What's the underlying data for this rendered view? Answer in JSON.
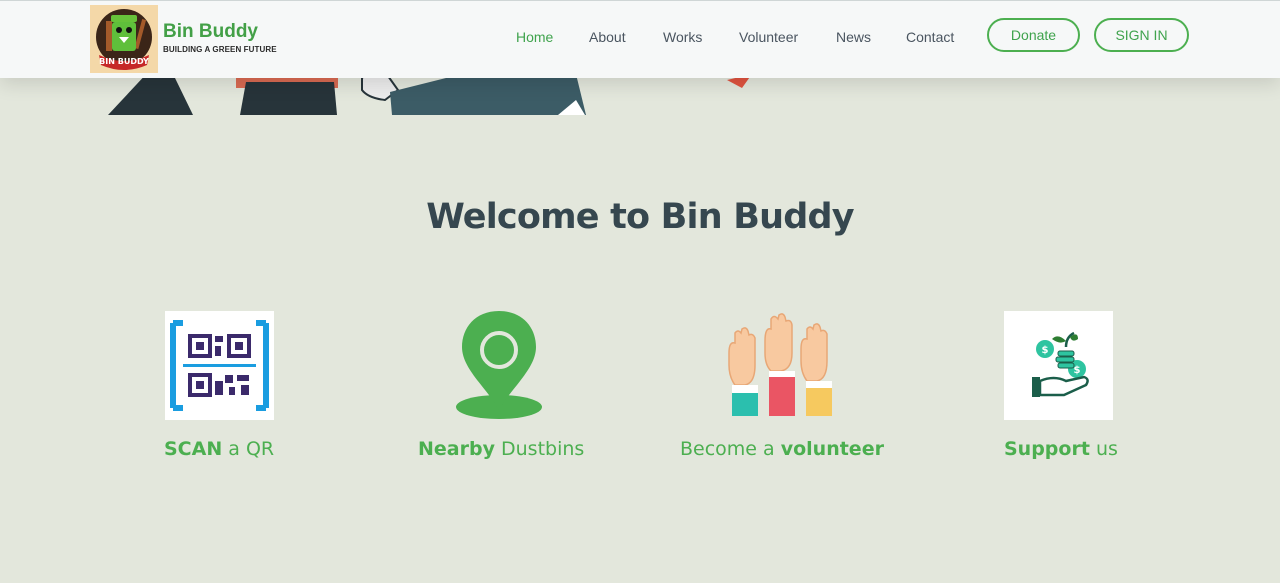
{
  "brand": {
    "name": "Bin Buddy",
    "tagline": "BUILDING A GREEN FUTURE",
    "logo_text": "BIN BUDDY"
  },
  "nav": {
    "items": [
      "Home",
      "About",
      "Works",
      "Volunteer",
      "News",
      "Contact"
    ],
    "active": "Home"
  },
  "buttons": {
    "donate": "Donate",
    "signin": "SIGN IN"
  },
  "welcome": {
    "title": "Welcome to Bin Buddy"
  },
  "features": [
    {
      "icon": "qr-code-icon",
      "bold": "SCAN",
      "rest": " a QR"
    },
    {
      "icon": "map-pin-icon",
      "bold": "Nearby",
      "rest": " Dustbins"
    },
    {
      "icon": "raised-hands-icon",
      "pre": "Become a ",
      "bold": "volunteer"
    },
    {
      "icon": "donation-plant-icon",
      "bold": "Support",
      "rest": " us"
    }
  ],
  "colors": {
    "accent": "#4caf50",
    "background": "#e3e7dc",
    "heading": "#36474f"
  }
}
